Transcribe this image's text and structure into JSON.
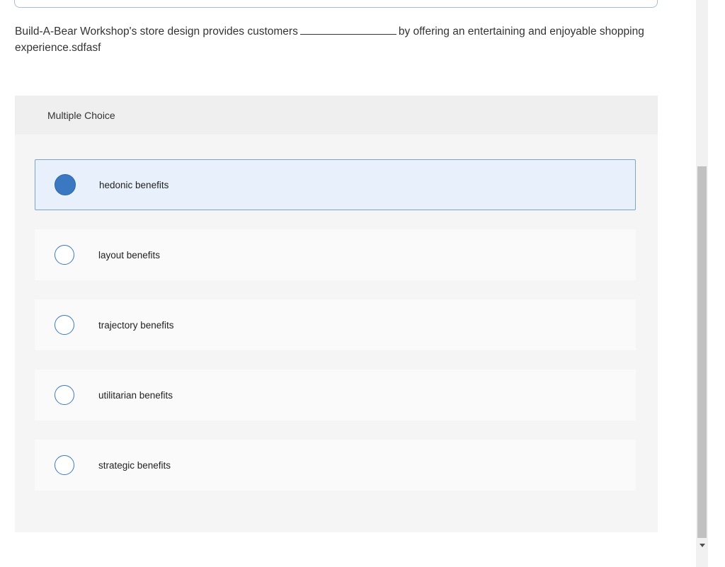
{
  "question": {
    "before_blank": "Build-A-Bear Workshop's store design provides customers",
    "after_blank": "by offering an entertaining and enjoyable shopping experience.sdfasf"
  },
  "mc": {
    "header": "Multiple Choice",
    "selected_index": 0,
    "options": [
      {
        "label": "hedonic benefits",
        "selected": true
      },
      {
        "label": "layout benefits",
        "selected": false
      },
      {
        "label": "trajectory benefits",
        "selected": false
      },
      {
        "label": "utilitarian benefits",
        "selected": false
      },
      {
        "label": "strategic benefits",
        "selected": false
      }
    ]
  },
  "colors": {
    "radio_accent": "#3b78c2",
    "selected_bg": "#e8f1fb",
    "panel_bg": "#f5f5f5"
  },
  "icons": {
    "scroll_down": "triangle-down-icon"
  }
}
